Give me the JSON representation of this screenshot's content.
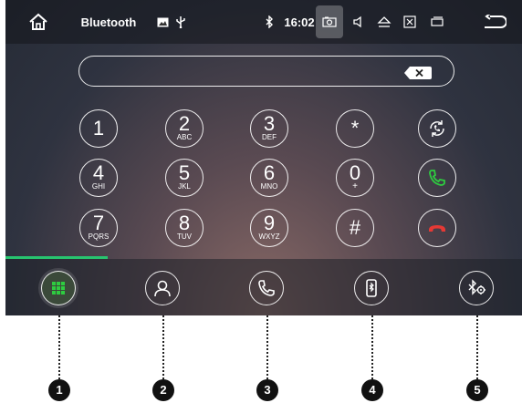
{
  "statusbar": {
    "title": "Bluetooth",
    "time": "16:02",
    "icons": [
      "home-icon",
      "image-icon",
      "usb-icon",
      "bluetooth-icon",
      "camera-icon",
      "volume-icon",
      "eject-icon",
      "close-box-icon",
      "window-icon",
      "back-icon"
    ]
  },
  "dialer": {
    "number_value": "",
    "keys": [
      {
        "digit": "1",
        "letters": ""
      },
      {
        "digit": "2",
        "letters": "ABC"
      },
      {
        "digit": "3",
        "letters": "DEF"
      },
      {
        "digit": "*",
        "letters": ""
      },
      {
        "digit": "4",
        "letters": "GHI"
      },
      {
        "digit": "5",
        "letters": "JKL"
      },
      {
        "digit": "6",
        "letters": "MNO"
      },
      {
        "digit": "0",
        "letters": "+"
      },
      {
        "digit": "7",
        "letters": "PQRS"
      },
      {
        "digit": "8",
        "letters": "TUV"
      },
      {
        "digit": "9",
        "letters": "WXYZ"
      },
      {
        "digit": "#",
        "letters": ""
      }
    ],
    "side_buttons": [
      "transfer-audio-icon",
      "call-icon",
      "hang-up-icon"
    ]
  },
  "tabbar": {
    "tabs": [
      "dialpad-icon",
      "contacts-icon",
      "call-log-icon",
      "bluetooth-device-icon",
      "bluetooth-settings-icon"
    ],
    "active_tab": 0,
    "progress_fraction": 0.2
  },
  "callouts": [
    "1",
    "2",
    "3",
    "4",
    "5"
  ],
  "colors": {
    "accent_green": "#27c46f",
    "call_green": "#2ecc40",
    "hangup_red": "#e53935"
  }
}
